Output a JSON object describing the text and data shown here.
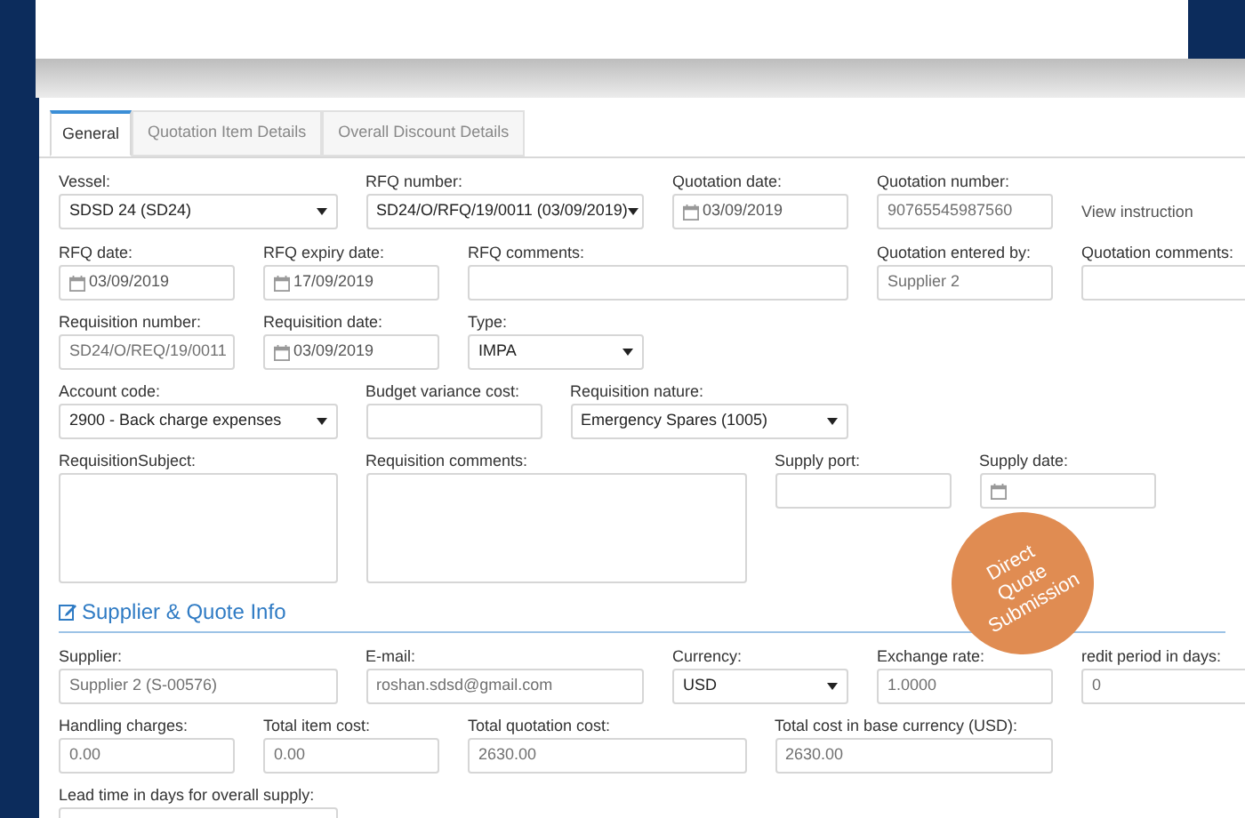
{
  "tabs": [
    {
      "label": "General",
      "selected": true
    },
    {
      "label": "Quotation Item Details",
      "selected": false
    },
    {
      "label": "Overall Discount Details",
      "selected": false
    }
  ],
  "form_rows": [
    [
      {
        "kind": "select",
        "label": "Vessel:",
        "value": "SDSD 24 (SD24)"
      },
      {
        "kind": "select",
        "label": "RFQ number:",
        "value": "SD24/O/RFQ/19/0011 (03/09/2019)"
      },
      {
        "kind": "date",
        "label": "Quotation date:",
        "value": "03/09/2019"
      },
      {
        "kind": "text",
        "label": "Quotation number:",
        "value": "90765545987560",
        "readonly": true
      },
      {
        "kind": "link",
        "value": "View instruction"
      }
    ],
    [
      {
        "kind": "date",
        "label": "RFQ date:",
        "value": "03/09/2019"
      },
      {
        "kind": "date",
        "label": "RFQ expiry date:",
        "value": "17/09/2019"
      },
      {
        "kind": "text",
        "label": "RFQ comments:"
      },
      {
        "kind": "text",
        "label": "Quotation entered by:",
        "value": "Supplier 2",
        "readonly": true
      },
      {
        "kind": "text",
        "label": "Quotation comments:"
      }
    ],
    [
      {
        "kind": "text",
        "label": "Requisition number:",
        "value": "SD24/O/REQ/19/0011",
        "readonly": true
      },
      {
        "kind": "date",
        "label": "Requisition date:",
        "value": "03/09/2019"
      },
      {
        "kind": "select",
        "label": "Type:",
        "value": "IMPA"
      }
    ],
    [
      {
        "kind": "select",
        "label": "Account code:",
        "value": "2900 - Back charge expenses"
      },
      {
        "kind": "text",
        "label": "Budget variance cost:"
      },
      {
        "kind": "select",
        "label": "Requisition nature:",
        "value": "Emergency Spares (1005)"
      }
    ],
    [
      {
        "kind": "textarea",
        "label": "RequisitionSubject:"
      },
      {
        "kind": "textarea",
        "label": "Requisition comments:"
      },
      {
        "kind": "text",
        "label": "Supply port:"
      },
      {
        "kind": "date",
        "label": "Supply date:"
      }
    ]
  ],
  "section": {
    "title": "Supplier & Quote Info"
  },
  "supplier_rows": [
    [
      {
        "kind": "text",
        "label": "Supplier:",
        "value": "Supplier 2 (S-00576)",
        "readonly": true
      },
      {
        "kind": "text",
        "label": "E-mail:",
        "value": "roshan.sdsd@gmail.com",
        "readonly": true
      },
      {
        "kind": "select",
        "label": "Currency:",
        "value": "USD"
      },
      {
        "kind": "text",
        "label": "Exchange rate:",
        "value": "1.0000",
        "readonly": true
      },
      {
        "kind": "text",
        "label": "redit period in days:",
        "value": "0",
        "readonly": true
      }
    ],
    [
      {
        "kind": "text",
        "label": "Handling charges:",
        "value": "0.00",
        "readonly": true
      },
      {
        "kind": "text",
        "label": "Total item cost:",
        "value": "0.00",
        "readonly": true
      },
      {
        "kind": "text",
        "label": "Total quotation cost:",
        "value": "2630.00",
        "readonly": true
      },
      {
        "kind": "text",
        "label": "Total cost in base currency (USD):",
        "value": "2630.00",
        "readonly": true
      }
    ],
    [
      {
        "kind": "text",
        "label": "Lead time in days for overall supply:"
      }
    ]
  ],
  "badge": {
    "lines": [
      "Direct",
      "Quote",
      "Submission"
    ]
  }
}
